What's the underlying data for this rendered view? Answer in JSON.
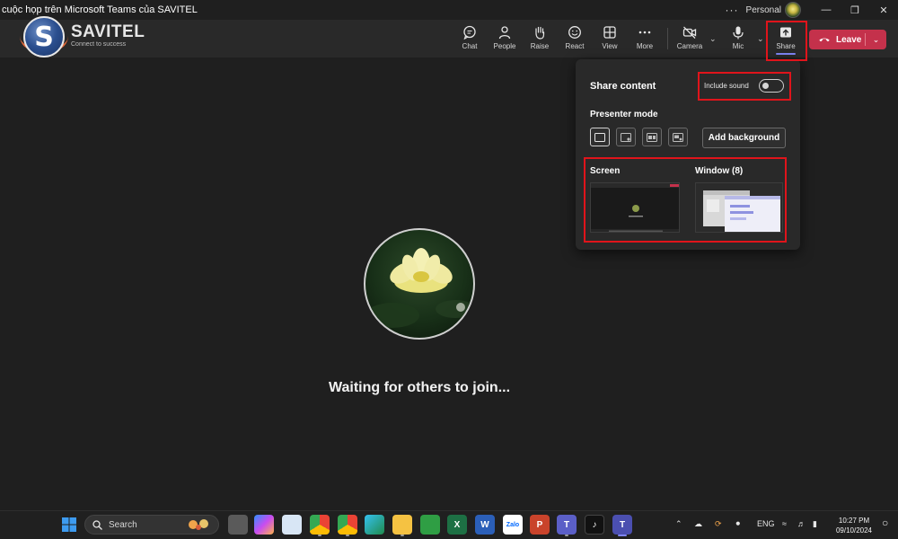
{
  "window": {
    "title": "cuộc họp trên Microsoft Teams của SAVITEL",
    "more": "···",
    "profile": "Personal"
  },
  "brand": {
    "letter": "S",
    "name": "SAVITEL",
    "tagline": "Connect to success"
  },
  "toolbar": {
    "chat": "Chat",
    "people": "People",
    "raise": "Raise",
    "react": "React",
    "view": "View",
    "more": "More",
    "camera": "Camera",
    "mic": "Mic",
    "share": "Share",
    "leave": "Leave"
  },
  "stage": {
    "status": "Waiting for others to join..."
  },
  "share_panel": {
    "title": "Share content",
    "include_sound": "Include sound",
    "include_sound_on": false,
    "presenter_mode": "Presenter mode",
    "add_background": "Add background",
    "screen": "Screen",
    "window": "Window (8)"
  },
  "taskbar": {
    "search": "Search",
    "language": "ENG",
    "time": "10:27 PM",
    "date": "09/10/2024"
  },
  "colors": {
    "leave": "#c4314b",
    "accent": "#7f85f5",
    "highlight": "#e0141b"
  }
}
